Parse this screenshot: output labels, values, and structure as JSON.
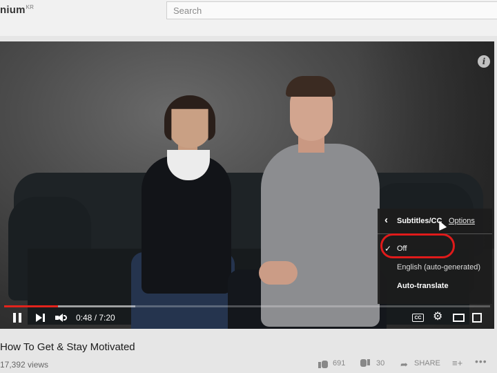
{
  "header": {
    "logo_text": "nium",
    "logo_suffix": "KR",
    "search_placeholder": "Search"
  },
  "player": {
    "progress_fraction": 0.111,
    "buffer_fraction": 0.27,
    "current_time": "0:48",
    "duration": "7:20",
    "time_display": "0:48 / 7:20",
    "info_icon_text": "i",
    "cc_icon_text": "CC",
    "accent_color": "#e3231c"
  },
  "subtitles_menu": {
    "back_glyph": "‹",
    "title": "Subtitles/CC",
    "options_label": "Options",
    "selected_check": "✓",
    "items": [
      {
        "label": "Off",
        "selected": true
      },
      {
        "label": "English (auto-generated)",
        "selected": false
      },
      {
        "label": "Auto-translate",
        "selected": false,
        "highlighted": true
      }
    ]
  },
  "video": {
    "title": "How To Get & Stay Motivated",
    "views": "17,392 views",
    "likes": "691",
    "dislikes": "30",
    "share_label": "SHARE",
    "more_glyph": "•••",
    "add_glyph": "≡+"
  }
}
